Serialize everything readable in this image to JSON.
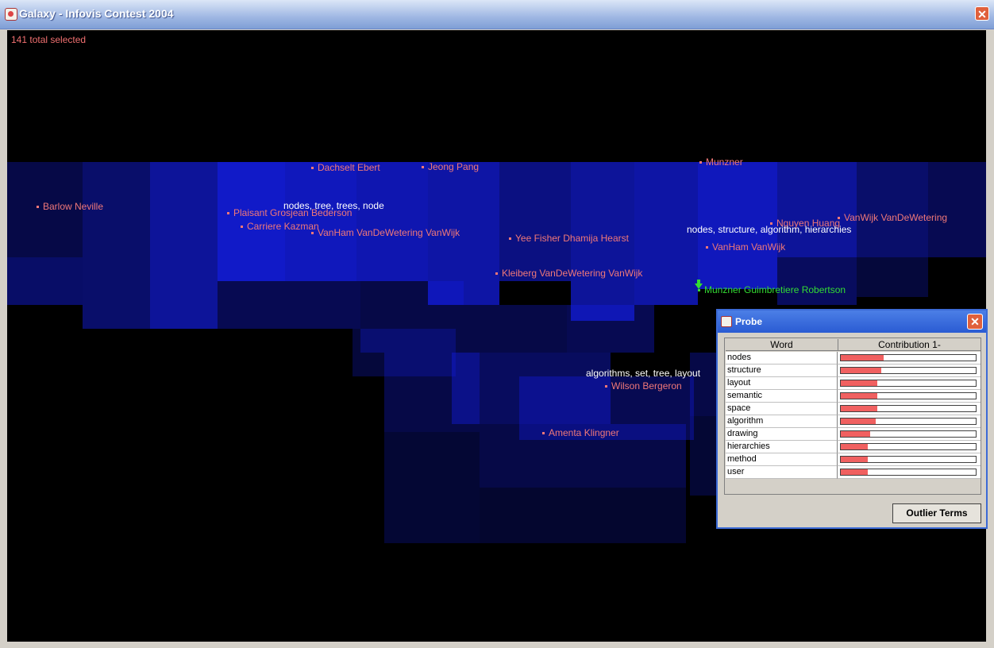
{
  "window": {
    "title": "Galaxy - Infovis Contest 2004",
    "close_label": "✕"
  },
  "canvas": {
    "status": "141 total selected"
  },
  "documents": [
    {
      "label": "Dachselt Ebert"
    },
    {
      "label": "Jeong Pang"
    },
    {
      "label": "Munzner"
    },
    {
      "label": "Barlow Neville"
    },
    {
      "label": "Plaisant Grosjean Bederson"
    },
    {
      "label": "Carriere Kazman"
    },
    {
      "label": "VanHam VanDeWetering VanWijk"
    },
    {
      "label": "Yee Fisher Dhamija Hearst"
    },
    {
      "label": "Nguyen Huang"
    },
    {
      "label": "VanWijk VanDeWetering"
    },
    {
      "label": "VanHam VanWijk"
    },
    {
      "label": "Kleiberg VanDeWetering VanWijk"
    },
    {
      "label": "Munzner Guimbretiere Robertson"
    },
    {
      "label": "Wilson Bergeron"
    },
    {
      "label": "Amenta Klingner"
    }
  ],
  "themes": [
    {
      "label": "nodes, tree, trees, node"
    },
    {
      "label": "nodes, structure, algorithm, hierarchies"
    },
    {
      "label": "algorithms, set, tree, layout"
    }
  ],
  "probe": {
    "title": "Probe",
    "close_label": "✕",
    "columns": [
      "Word",
      "Contribution 1-"
    ],
    "rows": [
      {
        "word": "nodes",
        "contribution": 0.32
      },
      {
        "word": "structure",
        "contribution": 0.3
      },
      {
        "word": "layout",
        "contribution": 0.27
      },
      {
        "word": "semantic",
        "contribution": 0.27
      },
      {
        "word": "space",
        "contribution": 0.27
      },
      {
        "word": "algorithm",
        "contribution": 0.26
      },
      {
        "word": "drawing",
        "contribution": 0.22
      },
      {
        "word": "hierarchies",
        "contribution": 0.2
      },
      {
        "word": "method",
        "contribution": 0.2
      },
      {
        "word": "user",
        "contribution": 0.2
      }
    ],
    "outlier_button": "Outlier Terms"
  }
}
